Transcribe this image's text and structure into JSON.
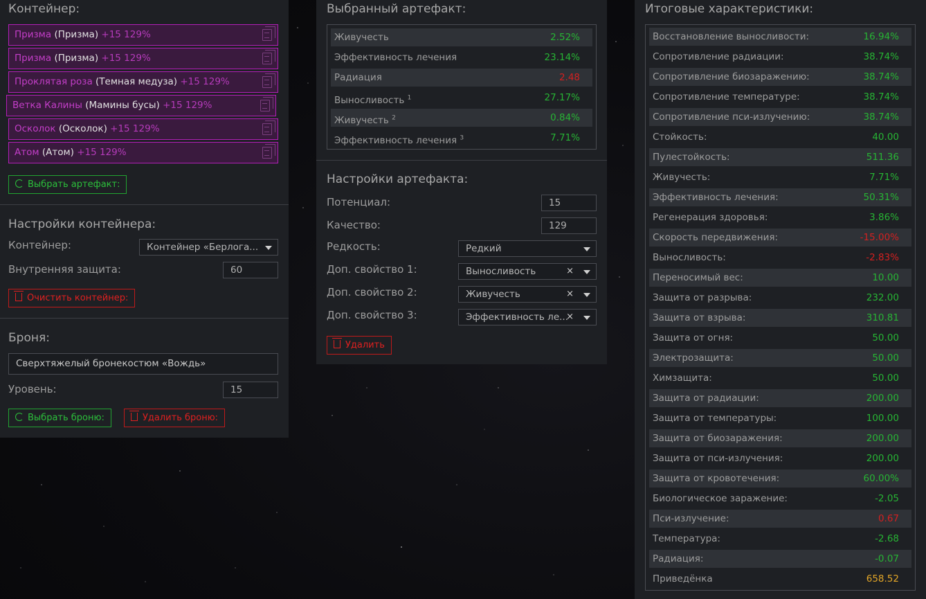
{
  "left": {
    "container_title": "Контейнер:",
    "items": [
      {
        "name": "Призма",
        "type": "(Призма)",
        "level": "+15 129%"
      },
      {
        "name": "Призма",
        "type": "(Призма)",
        "level": "+15 129%"
      },
      {
        "name": "Проклятая роза",
        "type": "(Темная медуза)",
        "level": "+15 129%"
      },
      {
        "name": "Ветка Калины",
        "type": "(Мамины бусы)",
        "level": "+15 129%"
      },
      {
        "name": "Осколок",
        "type": "(Осколок)",
        "level": "+15 129%"
      },
      {
        "name": "Атом",
        "type": "(Атом)",
        "level": "+15 129%"
      }
    ],
    "select_artifact_label": "Выбрать артефакт:",
    "container_settings_title": "Настройки контейнера:",
    "container_label": "Контейнер:",
    "container_value": "Контейнер «Берлога...",
    "inner_protection_label": "Внутренняя защита:",
    "inner_protection_value": "60",
    "clear_container_label": "Очистить контейнер:",
    "armor_title": "Броня:",
    "armor_value": "Сверхтяжелый бронекостюм «Вождь»",
    "level_label": "Уровень:",
    "level_value": "15",
    "select_armor_label": "Выбрать броню:",
    "delete_armor_label": "Удалить броню:"
  },
  "mid": {
    "selected_title": "Выбранный артефакт:",
    "stats": [
      {
        "label": "Живучесть",
        "sup": "",
        "value": "2.52%",
        "color": "green"
      },
      {
        "label": "Эффективность лечения",
        "sup": "",
        "value": "23.14%",
        "color": "green"
      },
      {
        "label": "Радиация",
        "sup": "",
        "value": "2.48",
        "color": "red"
      },
      {
        "label": "Выносливость",
        "sup": "1",
        "value": "27.17%",
        "color": "green"
      },
      {
        "label": "Живучесть",
        "sup": "2",
        "value": "0.84%",
        "color": "green"
      },
      {
        "label": "Эффективность лечения",
        "sup": "3",
        "value": "7.71%",
        "color": "green"
      }
    ],
    "settings_title": "Настройки артефакта:",
    "potential_label": "Потенциал:",
    "potential_value": "15",
    "quality_label": "Качество:",
    "quality_value": "129",
    "rarity_label": "Редкость:",
    "rarity_value": "Редкий",
    "prop1_label": "Доп. свойство 1:",
    "prop1_value": "Выносливость",
    "prop2_label": "Доп. свойство 2:",
    "prop2_value": "Живучесть",
    "prop3_label": "Доп. свойство 3:",
    "prop3_value": "Эффективность ле...",
    "clear_symbol": "×",
    "delete_label": "Удалить"
  },
  "right": {
    "title": "Итоговые характеристики:",
    "stats": [
      {
        "label": "Восстановление выносливости:",
        "value": "16.94%",
        "color": "green"
      },
      {
        "label": "Сопротивление радиации:",
        "value": "38.74%",
        "color": "green"
      },
      {
        "label": "Сопротивление биозаражению:",
        "value": "38.74%",
        "color": "green"
      },
      {
        "label": "Сопротивление температуре:",
        "value": "38.74%",
        "color": "green"
      },
      {
        "label": "Сопротивление пси-излучению:",
        "value": "38.74%",
        "color": "green"
      },
      {
        "label": "Стойкость:",
        "value": "40.00",
        "color": "green"
      },
      {
        "label": "Пулестойкость:",
        "value": "511.36",
        "color": "green"
      },
      {
        "label": "Живучесть:",
        "value": "7.71%",
        "color": "green"
      },
      {
        "label": "Эффективность лечения:",
        "value": "50.31%",
        "color": "green"
      },
      {
        "label": "Регенерация здоровья:",
        "value": "3.86%",
        "color": "green"
      },
      {
        "label": "Скорость передвижения:",
        "value": "-15.00%",
        "color": "red"
      },
      {
        "label": "Выносливость:",
        "value": "-2.83%",
        "color": "red"
      },
      {
        "label": "Переносимый вес:",
        "value": "10.00",
        "color": "green"
      },
      {
        "label": "Защита от разрыва:",
        "value": "232.00",
        "color": "green"
      },
      {
        "label": "Защита от взрыва:",
        "value": "310.81",
        "color": "green"
      },
      {
        "label": "Защита от огня:",
        "value": "50.00",
        "color": "green"
      },
      {
        "label": "Электрозащита:",
        "value": "50.00",
        "color": "green"
      },
      {
        "label": "Химзащита:",
        "value": "50.00",
        "color": "green"
      },
      {
        "label": "Защита от радиации:",
        "value": "200.00",
        "color": "green"
      },
      {
        "label": "Защита от температуры:",
        "value": "100.00",
        "color": "green"
      },
      {
        "label": "Защита от биозаражения:",
        "value": "200.00",
        "color": "green"
      },
      {
        "label": "Защита от пси-излучения:",
        "value": "200.00",
        "color": "green"
      },
      {
        "label": "Защита от кровотечения:",
        "value": "60.00%",
        "color": "green"
      },
      {
        "label": "Биологическое заражение:",
        "value": "-2.05",
        "color": "green"
      },
      {
        "label": "Пси-излучение:",
        "value": "0.67",
        "color": "red"
      },
      {
        "label": "Температура:",
        "value": "-2.68",
        "color": "green"
      },
      {
        "label": "Радиация:",
        "value": "-0.07",
        "color": "green"
      },
      {
        "label": "Приведёнка",
        "value": "658.52",
        "color": "orange"
      }
    ]
  }
}
